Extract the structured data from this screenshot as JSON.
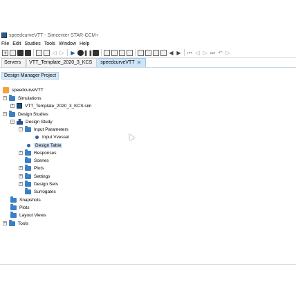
{
  "window": {
    "title": "speedcurveVTT - Simcenter STAR-CCM+"
  },
  "menubar": {
    "items": [
      "File",
      "Edit",
      "Studies",
      "Tools",
      "Window",
      "Help"
    ]
  },
  "toolbar": {
    "icons": [
      "new-icon",
      "open-icon",
      "save-icon",
      "save-all-icon",
      "copy-icon",
      "delete-icon",
      "back-icon",
      "forward-icon",
      "run-icon",
      "record-icon",
      "pause-icon",
      "stop-icon",
      "mesh-icon",
      "grid-icon",
      "select-icon",
      "filter-icon",
      "view-icon",
      "layout-icon",
      "zoom-icon",
      "fit-icon",
      "arrow-left-icon",
      "arrow-right-icon",
      "step-back-icon",
      "prev-icon",
      "next-icon",
      "step-forward-icon",
      "undo-icon",
      "play-icon"
    ]
  },
  "tabs": [
    {
      "label": "Servers",
      "active": false
    },
    {
      "label": "VTT_Template_2020_3_KCS",
      "active": false
    },
    {
      "label": "speedcurveVTT",
      "active": true,
      "closable": true
    }
  ],
  "panel": {
    "header": "Design Manager Project"
  },
  "tree": {
    "root": "speedcurveVTT",
    "simulations": "Simulations",
    "sim_file": "VTT_Template_2020_3_KCS.sim",
    "design_studies": "Design Studies",
    "design_study": "Design Study",
    "input_parameters": "Input Parameters",
    "input_vvessel": "Input Vvessel",
    "design_table": "Design Table",
    "responses": "Responses",
    "scenes": "Scenes",
    "plots_child": "Plots",
    "settings": "Settings",
    "design_sets": "Design Sets",
    "surrogates": "Surrogates",
    "snapshots": "Snapshots",
    "plots": "Plots",
    "layout_views": "Layout Views",
    "tools": "Tools"
  }
}
